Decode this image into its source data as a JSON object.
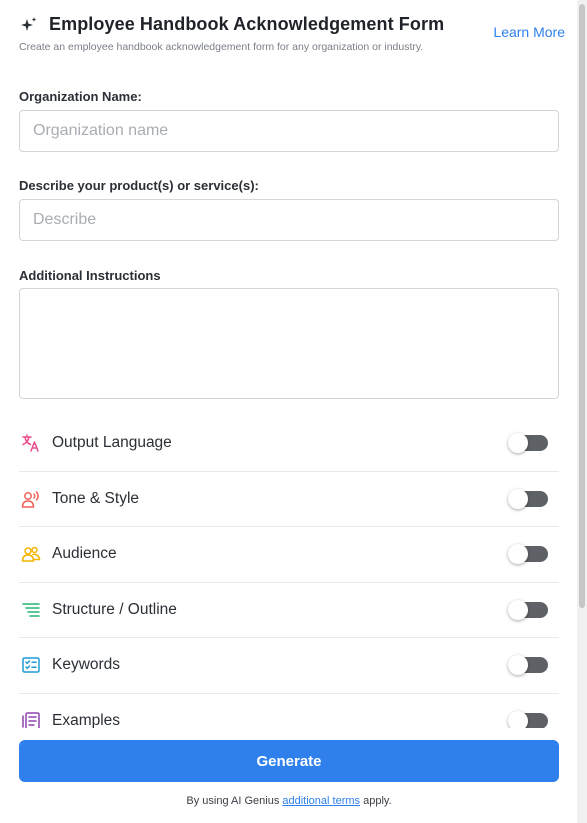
{
  "header": {
    "title": "Employee Handbook Acknowledgement Form",
    "subtitle": "Create an employee handbook acknowledgement form for any organization or industry.",
    "learn_more": "Learn More",
    "icon": "sparkle-icon"
  },
  "form": {
    "org_label": "Organization Name:",
    "org_placeholder": "Organization name",
    "org_value": "",
    "describe_label": "Describe your product(s) or service(s):",
    "describe_placeholder": "Describe",
    "describe_value": "",
    "instructions_label": "Additional Instructions",
    "instructions_value": ""
  },
  "options": [
    {
      "label": "Output Language",
      "icon": "translate-icon",
      "color": "#e94b8a",
      "enabled": false
    },
    {
      "label": "Tone & Style",
      "icon": "speaking-person-icon",
      "color": "#f0625a",
      "enabled": false
    },
    {
      "label": "Audience",
      "icon": "audience-icon",
      "color": "#f4b400",
      "enabled": false
    },
    {
      "label": "Structure / Outline",
      "icon": "outline-icon",
      "color": "#22b573",
      "enabled": false
    },
    {
      "label": "Keywords",
      "icon": "keywords-icon",
      "color": "#1e9bd7",
      "enabled": false
    },
    {
      "label": "Examples",
      "icon": "examples-icon",
      "color": "#8e44ad",
      "enabled": false
    }
  ],
  "generate_label": "Generate",
  "footer": {
    "prefix": "By using AI Genius ",
    "link": "additional terms",
    "suffix": " apply."
  }
}
